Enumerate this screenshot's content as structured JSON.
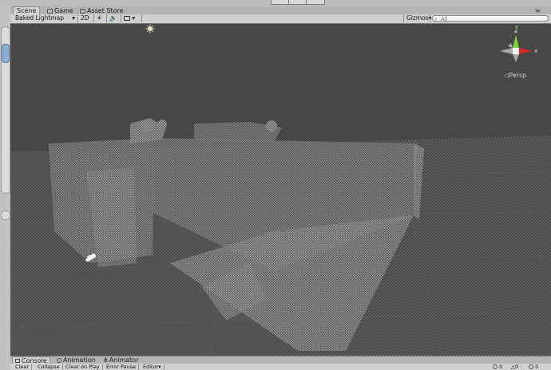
{
  "tabs": [
    {
      "label": "Scene",
      "active": true,
      "icon": "scene-icon"
    },
    {
      "label": "Game",
      "active": false,
      "icon": "game-icon"
    },
    {
      "label": "Asset Store",
      "active": false,
      "icon": "store-icon"
    }
  ],
  "toolbar": {
    "render_mode": "Baked Lightmap",
    "two_d_label": "2D",
    "gizmos_label": "Gizmos",
    "search_placeholder": "All"
  },
  "scene": {
    "projection_label": "Persp",
    "gizmo_axes": {
      "y": "y",
      "x": "x"
    },
    "colors": {
      "background": "#474747",
      "grid": "#5a5a5a",
      "axis_y": "#7bd43a",
      "axis_x": "#d02a2a"
    }
  },
  "bottom_tabs": [
    {
      "label": "Console",
      "active": true,
      "icon": "console-icon"
    },
    {
      "label": "Animation",
      "active": false,
      "icon": "animation-icon"
    },
    {
      "label": "Animator",
      "active": false,
      "icon": "animator-icon"
    }
  ],
  "console_toolbar": {
    "clear": "Clear",
    "collapse": "Collapse",
    "clear_on_play": "Clear on Play",
    "error_pause": "Error Pause",
    "editor": "Editor",
    "counts": [
      "0",
      "0",
      "0"
    ]
  }
}
